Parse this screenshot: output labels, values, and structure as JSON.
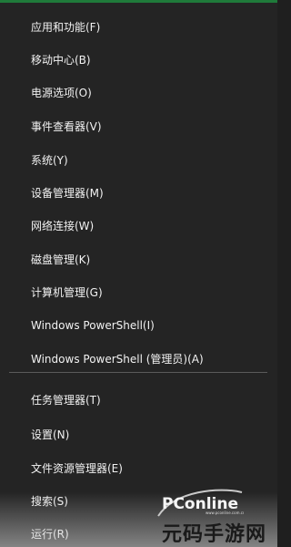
{
  "colors": {
    "background": "#242424",
    "accent": "#1f7a3a",
    "text": "#f2f2f2",
    "separator": "#5a5a5a"
  },
  "menu": {
    "group1": [
      {
        "label": "应用和功能(F)"
      },
      {
        "label": "移动中心(B)"
      },
      {
        "label": "电源选项(O)"
      },
      {
        "label": "事件查看器(V)"
      },
      {
        "label": "系统(Y)"
      },
      {
        "label": "设备管理器(M)"
      },
      {
        "label": "网络连接(W)"
      },
      {
        "label": "磁盘管理(K)"
      },
      {
        "label": "计算机管理(G)"
      },
      {
        "label": "Windows PowerShell(I)"
      },
      {
        "label": "Windows PowerShell (管理员)(A)"
      }
    ],
    "group2": [
      {
        "label": "任务管理器(T)"
      },
      {
        "label": "设置(N)"
      },
      {
        "label": "文件资源管理器(E)"
      },
      {
        "label": "搜索(S)"
      },
      {
        "label": "运行(R)"
      }
    ]
  },
  "watermark": {
    "logo_text": "PConline",
    "logo_small": "www.pconline.com.cn",
    "site_text": "元码手游网"
  }
}
